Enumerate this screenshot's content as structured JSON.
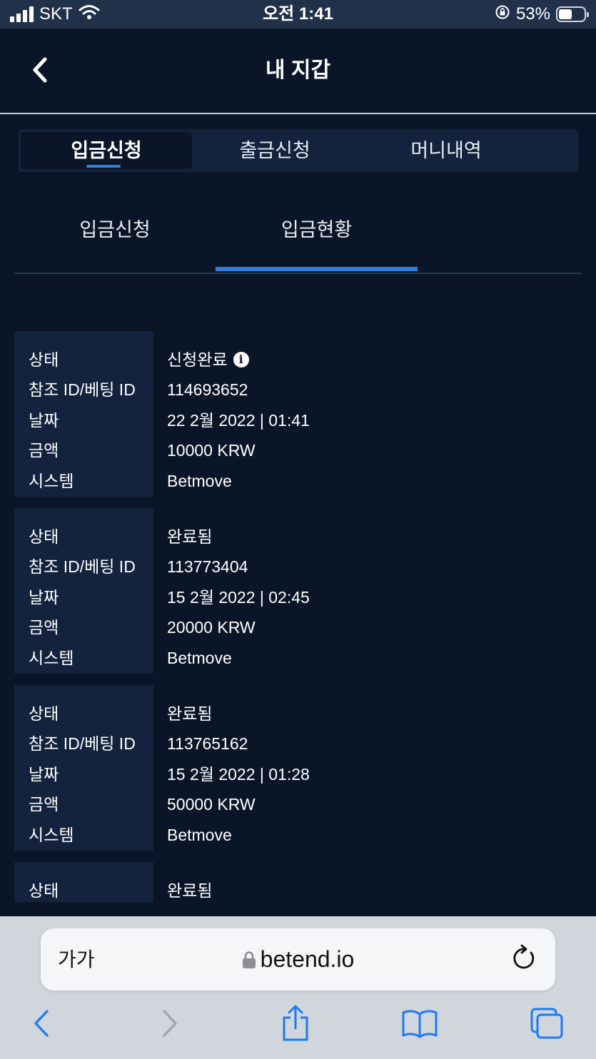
{
  "status_bar": {
    "carrier": "SKT",
    "time": "오전 1:41",
    "battery": "53%",
    "battery_level": 0.53
  },
  "header": {
    "title": "내 지갑"
  },
  "tabs": [
    {
      "label": "입금신청",
      "active": true
    },
    {
      "label": "출금신청",
      "active": false
    },
    {
      "label": "머니내역",
      "active": false
    }
  ],
  "subtabs": [
    {
      "label": "입금신청",
      "active": false
    },
    {
      "label": "입금현황",
      "active": true
    }
  ],
  "records": [
    {
      "fields": [
        {
          "label": "상태",
          "value": "신청완료",
          "info_icon": true
        },
        {
          "label": "참조 ID/베팅 ID",
          "value": "114693652"
        },
        {
          "label": "날짜",
          "value": "22 2월 2022 | 01:41"
        },
        {
          "label": "금액",
          "value": "10000 KRW"
        },
        {
          "label": "시스템",
          "value": "Betmove"
        }
      ]
    },
    {
      "fields": [
        {
          "label": "상태",
          "value": "완료됨"
        },
        {
          "label": "참조 ID/베팅 ID",
          "value": "113773404"
        },
        {
          "label": "날짜",
          "value": "15 2월 2022 | 02:45"
        },
        {
          "label": "금액",
          "value": "20000 KRW"
        },
        {
          "label": "시스템",
          "value": "Betmove"
        }
      ]
    },
    {
      "fields": [
        {
          "label": "상태",
          "value": "완료됨"
        },
        {
          "label": "참조 ID/베팅 ID",
          "value": "113765162"
        },
        {
          "label": "날짜",
          "value": "15 2월 2022 | 01:28"
        },
        {
          "label": "금액",
          "value": "50000 KRW"
        },
        {
          "label": "시스템",
          "value": "Betmove"
        }
      ]
    },
    {
      "fields": [
        {
          "label": "상태",
          "value": "완료됨"
        }
      ]
    }
  ],
  "browser": {
    "text_size_label": "가가",
    "url": "betend.io"
  },
  "colors": {
    "background": "#0a1628",
    "panel": "#13233d",
    "accent": "#2f7de1",
    "safari_blue": "#1a7cf5"
  }
}
